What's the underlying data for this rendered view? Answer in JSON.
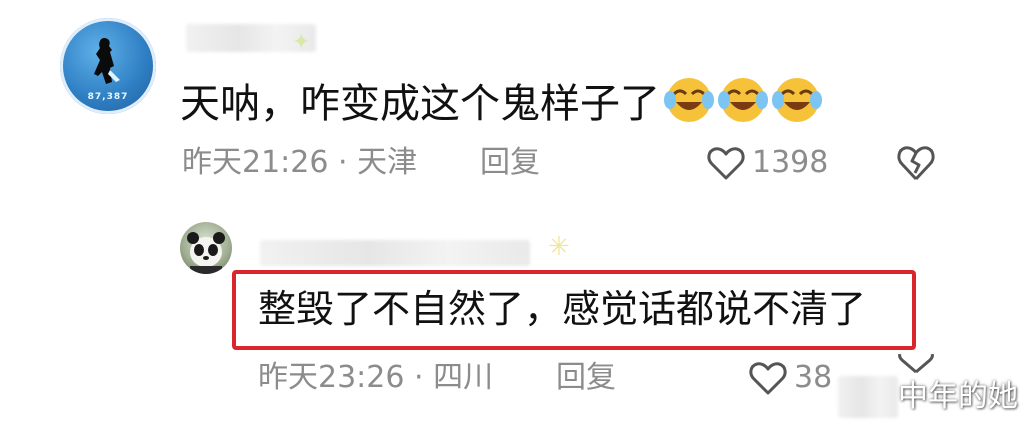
{
  "comment": {
    "text": "天呐，咋变成这个鬼样子了",
    "emojis": [
      "crying-laughing-emoji",
      "crying-laughing-emoji",
      "crying-laughing-emoji"
    ],
    "time_location": "昨天21:26 · 天津",
    "reply_label": "回复",
    "like_count": "1398",
    "avatar_tag": "87,387"
  },
  "reply": {
    "text": "整毁了不自然了，感觉话都说不清了",
    "time_location": "昨天23:26 · 四川",
    "reply_label": "回复",
    "like_count": "38"
  },
  "watermark": {
    "text": "中年的她"
  },
  "colors": {
    "highlight_border": "#d8262c",
    "meta_text": "#8c8c8c",
    "main_text": "#111111"
  }
}
